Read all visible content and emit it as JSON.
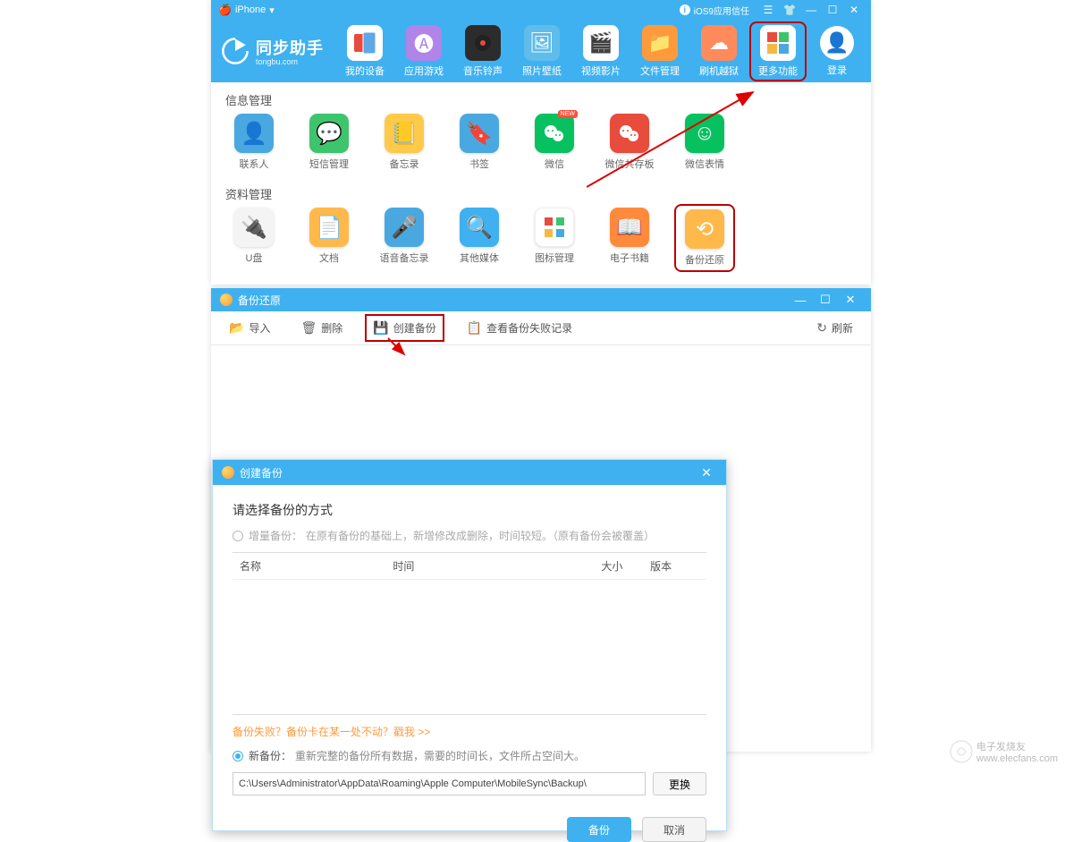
{
  "win1": {
    "titlebar": {
      "device": "iPhone",
      "trust": "iOS9应用信任"
    },
    "brand": {
      "name": "同步助手",
      "domain": "tongbu.com"
    },
    "nav": [
      {
        "label": "我的设备"
      },
      {
        "label": "应用游戏"
      },
      {
        "label": "音乐铃声"
      },
      {
        "label": "照片壁纸"
      },
      {
        "label": "视频影片"
      },
      {
        "label": "文件管理"
      },
      {
        "label": "刷机越狱"
      },
      {
        "label": "更多功能"
      }
    ],
    "login_label": "登录",
    "sections": {
      "info": {
        "title": "信息管理",
        "items": [
          {
            "label": "联系人"
          },
          {
            "label": "短信管理"
          },
          {
            "label": "备忘录"
          },
          {
            "label": "书签"
          },
          {
            "label": "微信",
            "new": true
          },
          {
            "label": "微信共存板"
          },
          {
            "label": "微信表情"
          }
        ]
      },
      "data": {
        "title": "资料管理",
        "items": [
          {
            "label": "U盘"
          },
          {
            "label": "文档"
          },
          {
            "label": "语音备忘录"
          },
          {
            "label": "其他媒体"
          },
          {
            "label": "图标管理"
          },
          {
            "label": "电子书籍"
          },
          {
            "label": "备份还原"
          }
        ]
      }
    }
  },
  "win2": {
    "title": "备份还原",
    "toolbar": {
      "import": "导入",
      "delete": "删除",
      "create": "创建备份",
      "viewfail": "查看备份失败记录",
      "refresh": "刷新"
    },
    "dialog": {
      "title": "创建备份",
      "heading": "请选择备份的方式",
      "opt_incremental": "增量备份：",
      "opt_incremental_desc": "在原有备份的基础上，新增修改成删除，时间较短。（原有备份会被覆盖）",
      "columns": {
        "name": "名称",
        "time": "时间",
        "size": "大小",
        "version": "版本"
      },
      "help_link": "备份失败？备份卡在某一处不动？戳我 >>",
      "opt_new": "新备份：",
      "opt_new_desc": "重新完整的备份所有数据，需要的时间长，文件所占空间大。",
      "path": "C:\\Users\\Administrator\\AppData\\Roaming\\Apple Computer\\MobileSync\\Backup\\",
      "change": "更换",
      "ok": "备份",
      "cancel": "取消"
    }
  },
  "watermark": {
    "brand": "电子发烧友",
    "url": "www.elecfans.com"
  }
}
